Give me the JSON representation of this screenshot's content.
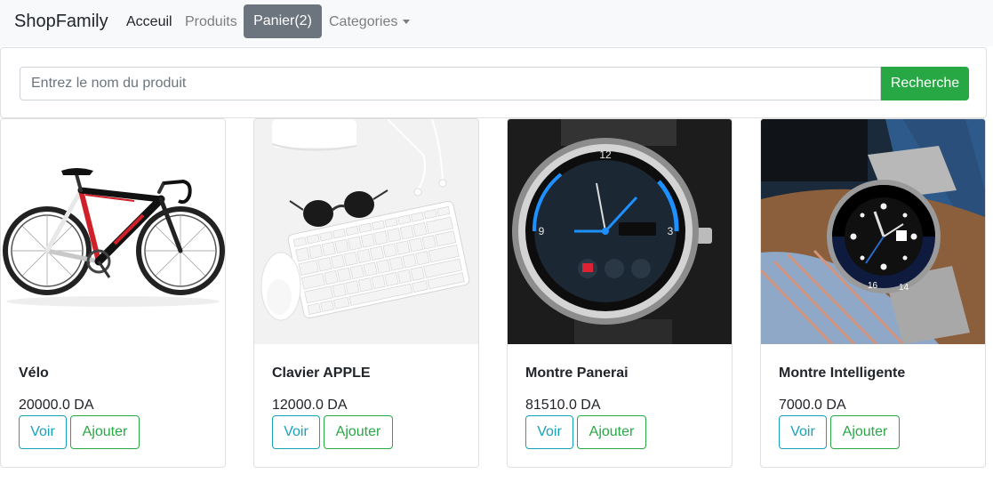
{
  "navbar": {
    "brand": "ShopFamily",
    "links": [
      {
        "label": "Acceuil"
      },
      {
        "label": "Produits"
      },
      {
        "label": "Panier(2)"
      },
      {
        "label": "Categories"
      }
    ]
  },
  "search": {
    "placeholder": "Entrez le nom du produit",
    "button_label": "Recherche"
  },
  "products": [
    {
      "name": "Vélo",
      "price": "20000.0 DA",
      "view_label": "Voir",
      "add_label": "Ajouter",
      "image": "bicycle"
    },
    {
      "name": "Clavier APPLE",
      "price": "12000.0 DA",
      "view_label": "Voir",
      "add_label": "Ajouter",
      "image": "keyboard-desk"
    },
    {
      "name": "Montre Panerai",
      "price": "81510.0 DA",
      "view_label": "Voir",
      "add_label": "Ajouter",
      "image": "smartwatch"
    },
    {
      "name": "Montre Intelligente",
      "price": "7000.0 DA",
      "view_label": "Voir",
      "add_label": "Ajouter",
      "image": "wristwatch"
    }
  ],
  "colors": {
    "navbar_bg": "#f8f9fa",
    "cart_bg": "#6c757d",
    "success": "#28a745",
    "info": "#17a2b8"
  }
}
